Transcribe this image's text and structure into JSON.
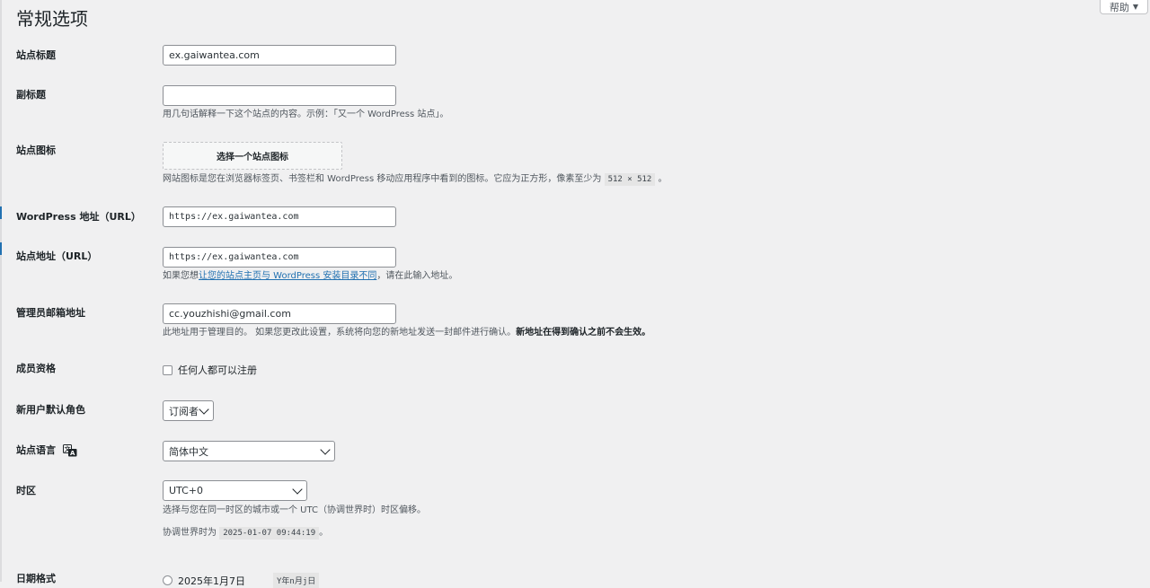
{
  "page": {
    "title": "常规选项"
  },
  "help": {
    "label": "帮助"
  },
  "site_title": {
    "label": "站点标题",
    "value": "ex.gaiwantea.com"
  },
  "tagline": {
    "label": "副标题",
    "value": "",
    "description": "用几句话解释一下这个站点的内容。示例：「又一个 WordPress 站点」。"
  },
  "site_icon": {
    "label": "站点图标",
    "button": "选择一个站点图标",
    "desc_before": "网站图标是您在浏览器标签页、书签栏和 WordPress 移动应用程序中看到的图标。它应为正方形，像素至少为",
    "size_code": "512 × 512",
    "desc_after": "。"
  },
  "wp_address": {
    "label": "WordPress 地址（URL）",
    "value": "https://ex.gaiwantea.com"
  },
  "site_address": {
    "label": "站点地址（URL）",
    "value": "https://ex.gaiwantea.com",
    "desc_before": "如果您想",
    "desc_link": "让您的站点主页与 WordPress 安装目录不同",
    "desc_after": "，请在此输入地址。"
  },
  "admin_email": {
    "label": "管理员邮箱地址",
    "value": "cc.youzhishi@gmail.com",
    "desc_plain": "此地址用于管理目的。 如果您更改此设置，系统将向您的新地址发送一封邮件进行确认。",
    "desc_bold": "新地址在得到确认之前不会生效。"
  },
  "membership": {
    "label": "成员资格",
    "checkbox_label": "任何人都可以注册",
    "checked": false
  },
  "default_role": {
    "label": "新用户默认角色",
    "value": "订阅者"
  },
  "site_language": {
    "label": "站点语言",
    "value": "简体中文",
    "icon": "translation-icon"
  },
  "timezone": {
    "label": "时区",
    "value": "UTC+0",
    "description": "选择与您在同一时区的城市或一个 UTC（协调世界时）时区偏移。",
    "utc_prefix": "协调世界时为",
    "utc_time": "2025-01-07 09:44:19",
    "utc_suffix": "。"
  },
  "date_format": {
    "label": "日期格式",
    "option_label": "2025年1月7日",
    "option_code": "Y年n月j日"
  }
}
